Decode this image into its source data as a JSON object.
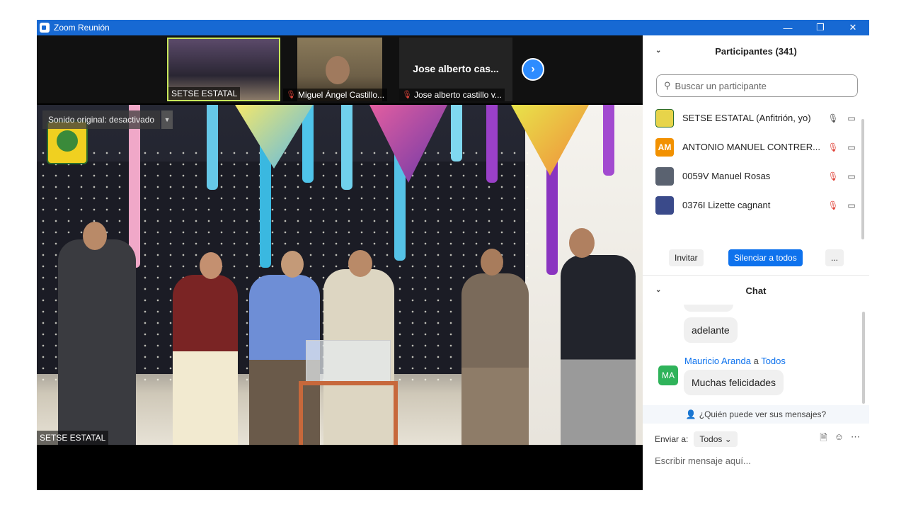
{
  "window": {
    "title": "Zoom Reunión",
    "minimize_icon": "minimize-icon",
    "restore_icon": "restore-icon",
    "close_icon": "close-icon"
  },
  "thumbnails": [
    {
      "label": "SETSE ESTATAL",
      "muted": false,
      "active": true
    },
    {
      "label": "Miguel Ángel Castillo...",
      "muted": true
    },
    {
      "label": "Jose alberto castillo v...",
      "big_name": "Jose alberto cas...",
      "muted": true
    }
  ],
  "main_video": {
    "sound_toggle": "Sonido original: desactivado",
    "speaker_name": "SETSE ESTATAL"
  },
  "participants": {
    "header": "Participantes (341)",
    "search_placeholder": "Buscar un participante",
    "items": [
      {
        "name": "SETSE ESTATAL (Anfitrión, yo)",
        "avatar_text": "",
        "avatar_color": "#e7d44a",
        "muted": false
      },
      {
        "name": "ANTONIO MANUEL CONTRER...",
        "avatar_text": "AM",
        "avatar_color": "#f29100",
        "muted": true
      },
      {
        "name": "0059V Manuel Rosas",
        "avatar_text": "",
        "avatar_color": "#5a6270",
        "muted": true
      },
      {
        "name": "0376I Lizette cagnant",
        "avatar_text": "",
        "avatar_color": "#3a4a8a",
        "muted": true
      }
    ],
    "invite_label": "Invitar",
    "mute_all_label": "Silenciar a todos",
    "more_label": "..."
  },
  "chat": {
    "header": "Chat",
    "messages": [
      {
        "text": "adelante"
      },
      {
        "sender": "Mauricio Aranda",
        "to_word": "a",
        "recipient": "Todos",
        "avatar_text": "MA",
        "text": "Muchas felicidades"
      }
    ],
    "who_can_see": "¿Quién puede ver sus mensajes?",
    "send_to_label": "Enviar a:",
    "send_to_value": "Todos",
    "input_placeholder": "Escribir mensaje aquí..."
  },
  "colors": {
    "zoom_blue": "#0e72ed",
    "titlebar": "#1769d3",
    "muted_red": "#e0443a"
  }
}
